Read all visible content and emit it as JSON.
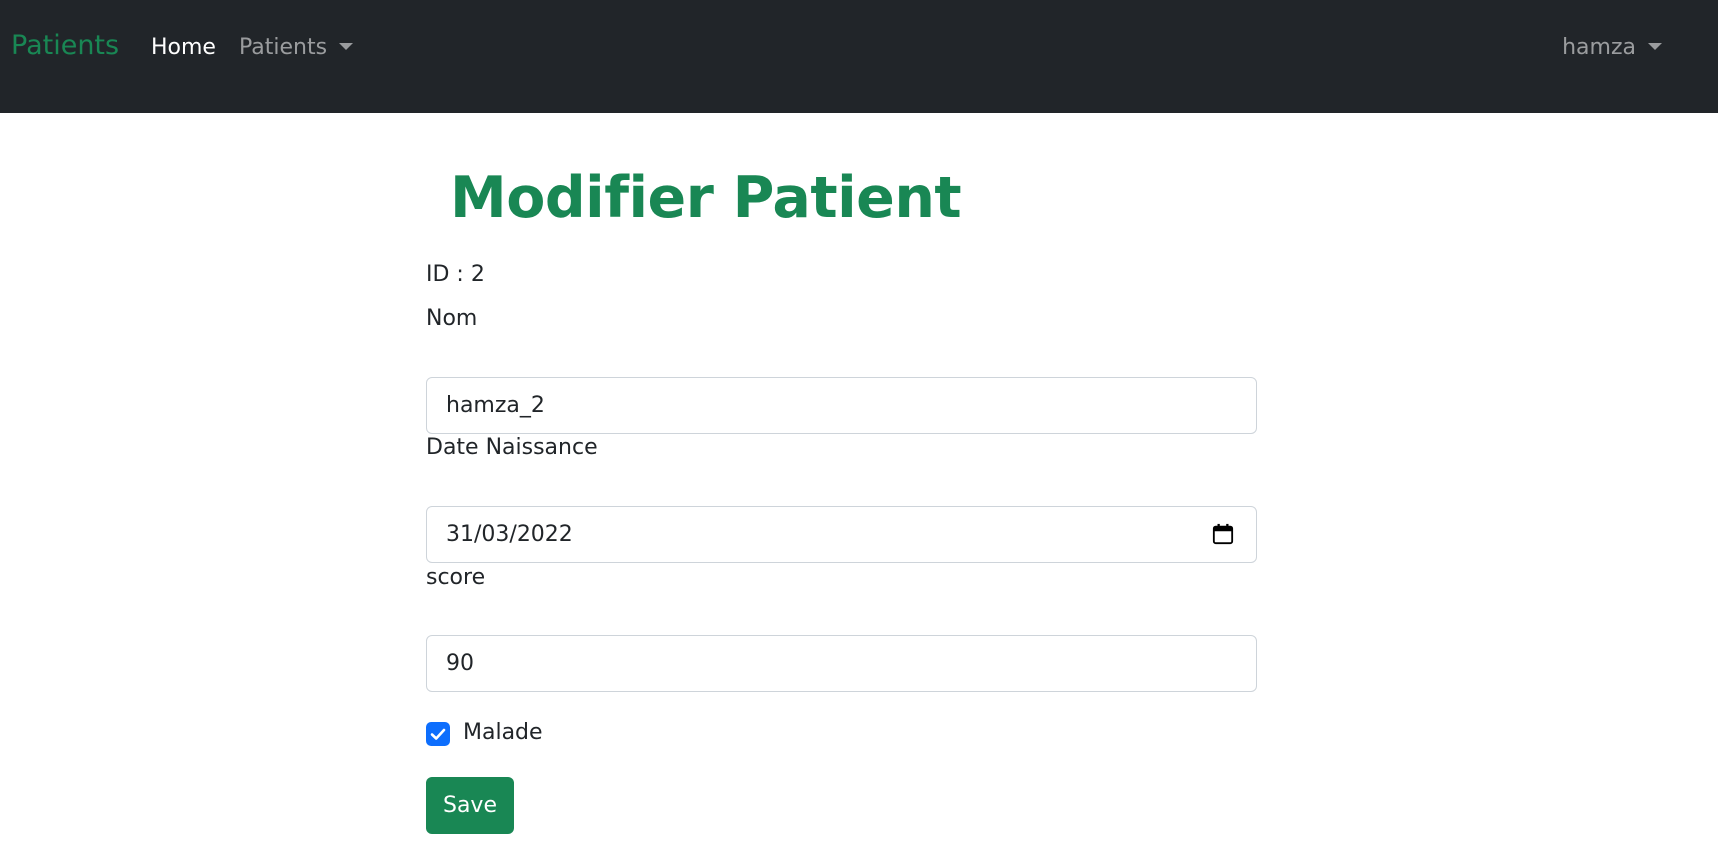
{
  "navbar": {
    "brand": "Patients",
    "items": [
      {
        "label": "Home"
      },
      {
        "label": "Patients"
      }
    ],
    "user": "hamza",
    "brand_color": "#198754",
    "background": "#212529"
  },
  "form": {
    "title": "Modifier Patient",
    "id_text": "ID : 2",
    "nom_label": "Nom",
    "nom_value": "hamza_2",
    "date_label": "Date Naissance",
    "date_value": "31/03/2022",
    "score_label": "score",
    "score_value": "90",
    "malade_label": "Malade",
    "malade_checked": true,
    "save_label": "Save"
  },
  "icons": {
    "calendar": "calendar-icon",
    "checkbox": "check-icon",
    "dropdown": "caret-down-icon"
  },
  "colors": {
    "accent": "#198754",
    "checkbox": "#0d6efd"
  }
}
